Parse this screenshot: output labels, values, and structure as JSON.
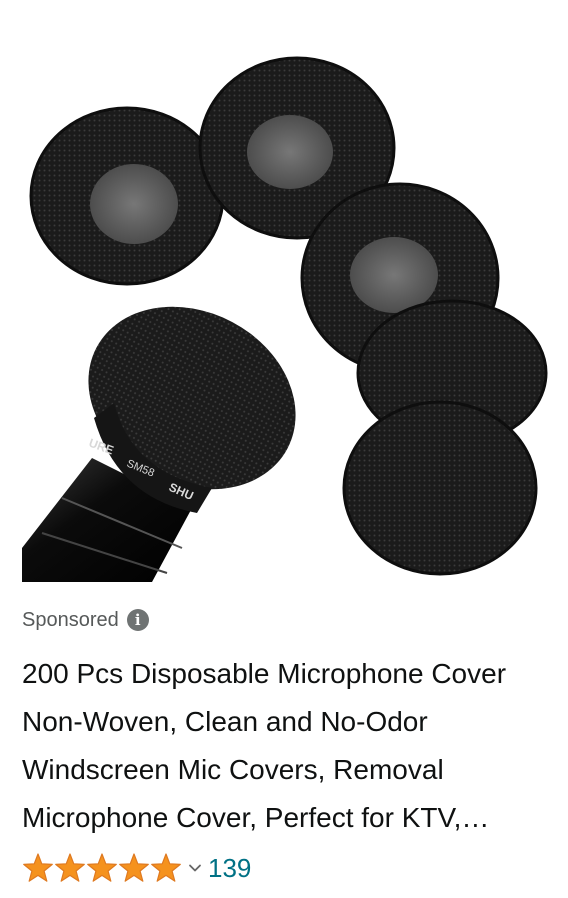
{
  "product": {
    "sponsored_label": "Sponsored",
    "info_glyph": "i",
    "title": "200 Pcs Disposable Microphone Cover Non-Woven, Clean and No-Odor Windscreen Mic Covers, Removal Microphone Cover, Perfect for KTV, Recording Room, Stage Performance",
    "image_text": {
      "brand_mark_1": "URE",
      "model_mark": "SM58",
      "brand_mark_2": "SHU"
    },
    "rating": {
      "stars": 5,
      "star_icon": "star-icon",
      "review_count": "139"
    }
  },
  "colors": {
    "star_fill": "#f5921e",
    "link_teal": "#007185",
    "muted_gray": "#565959",
    "cover_black": "#1c1c1c"
  }
}
